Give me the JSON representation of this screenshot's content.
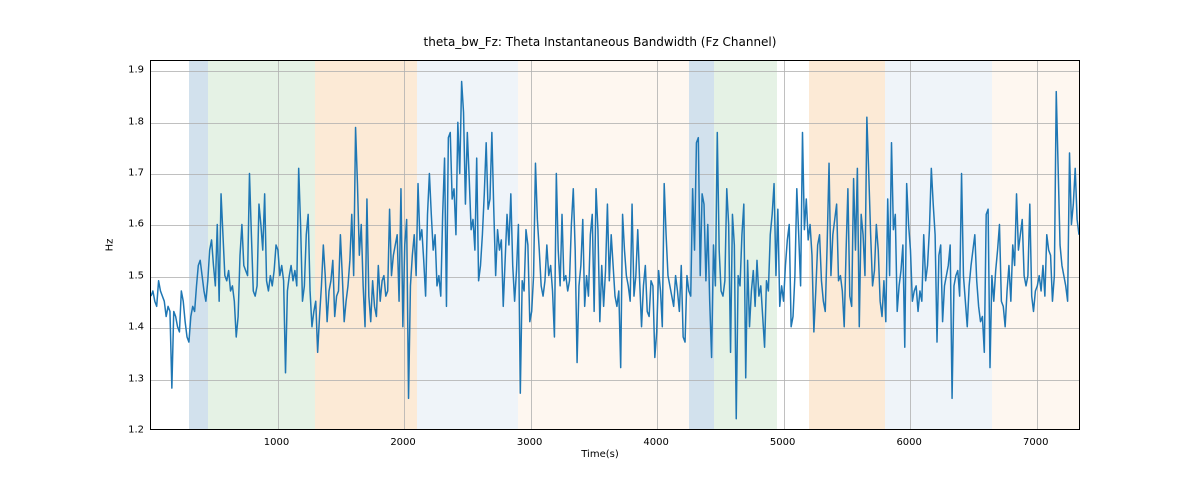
{
  "chart_data": {
    "type": "line",
    "title": "theta_bw_Fz: Theta Instantaneous Bandwidth (Fz Channel)",
    "xlabel": "Time(s)",
    "ylabel": "Hz",
    "xlim": [
      0,
      7350
    ],
    "ylim": [
      1.2,
      1.92
    ],
    "xticks": [
      1000,
      2000,
      3000,
      4000,
      5000,
      6000,
      7000
    ],
    "yticks": [
      1.2,
      1.3,
      1.4,
      1.5,
      1.6,
      1.7,
      1.8,
      1.9
    ],
    "bands": [
      {
        "x0": 300,
        "x1": 450,
        "color": "#6b9bc3"
      },
      {
        "x0": 450,
        "x1": 1300,
        "color": "#a8d5a8"
      },
      {
        "x0": 1300,
        "x1": 2100,
        "color": "#f5b878"
      },
      {
        "x0": 2100,
        "x1": 2900,
        "color": "#c9d9ec"
      },
      {
        "x0": 2900,
        "x1": 4250,
        "color": "#fde5cc"
      },
      {
        "x0": 4250,
        "x1": 4450,
        "color": "#6b9bc3"
      },
      {
        "x0": 4450,
        "x1": 4950,
        "color": "#a8d5a8"
      },
      {
        "x0": 5200,
        "x1": 5800,
        "color": "#f5b878"
      },
      {
        "x0": 5800,
        "x1": 6650,
        "color": "#c9d9ec"
      },
      {
        "x0": 6650,
        "x1": 7350,
        "color": "#fde5cc"
      }
    ],
    "series": [
      {
        "name": "theta_bw_Fz",
        "color": "#1f77b4",
        "x_start": 0,
        "x_step": 15,
        "values": [
          1.46,
          1.47,
          1.45,
          1.44,
          1.49,
          1.47,
          1.46,
          1.45,
          1.42,
          1.44,
          1.43,
          1.28,
          1.43,
          1.42,
          1.4,
          1.39,
          1.47,
          1.45,
          1.41,
          1.38,
          1.37,
          1.42,
          1.44,
          1.43,
          1.48,
          1.52,
          1.53,
          1.5,
          1.47,
          1.45,
          1.49,
          1.55,
          1.57,
          1.52,
          1.48,
          1.6,
          1.45,
          1.66,
          1.58,
          1.5,
          1.49,
          1.51,
          1.47,
          1.48,
          1.45,
          1.38,
          1.42,
          1.54,
          1.6,
          1.52,
          1.51,
          1.5,
          1.7,
          1.58,
          1.47,
          1.46,
          1.48,
          1.64,
          1.6,
          1.55,
          1.66,
          1.49,
          1.47,
          1.5,
          1.48,
          1.51,
          1.56,
          1.55,
          1.5,
          1.52,
          1.49,
          1.31,
          1.47,
          1.5,
          1.52,
          1.49,
          1.51,
          1.48,
          1.71,
          1.6,
          1.45,
          1.48,
          1.58,
          1.62,
          1.47,
          1.4,
          1.43,
          1.45,
          1.35,
          1.42,
          1.48,
          1.56,
          1.5,
          1.41,
          1.47,
          1.49,
          1.53,
          1.42,
          1.46,
          1.47,
          1.58,
          1.5,
          1.41,
          1.45,
          1.48,
          1.53,
          1.62,
          1.5,
          1.79,
          1.68,
          1.54,
          1.6,
          1.48,
          1.4,
          1.65,
          1.46,
          1.41,
          1.49,
          1.44,
          1.42,
          1.52,
          1.45,
          1.49,
          1.5,
          1.46,
          1.47,
          1.63,
          1.5,
          1.54,
          1.56,
          1.58,
          1.45,
          1.67,
          1.4,
          1.56,
          1.61,
          1.26,
          1.48,
          1.54,
          1.58,
          1.5,
          1.68,
          1.57,
          1.59,
          1.53,
          1.46,
          1.62,
          1.7,
          1.62,
          1.55,
          1.58,
          1.48,
          1.5,
          1.46,
          1.62,
          1.73,
          1.44,
          1.77,
          1.78,
          1.65,
          1.67,
          1.58,
          1.8,
          1.7,
          1.88,
          1.82,
          1.64,
          1.78,
          1.69,
          1.59,
          1.61,
          1.55,
          1.73,
          1.49,
          1.52,
          1.58,
          1.66,
          1.76,
          1.63,
          1.65,
          1.78,
          1.63,
          1.5,
          1.59,
          1.55,
          1.57,
          1.44,
          1.53,
          1.62,
          1.56,
          1.66,
          1.52,
          1.45,
          1.51,
          1.6,
          1.27,
          1.49,
          1.47,
          1.59,
          1.56,
          1.41,
          1.43,
          1.5,
          1.72,
          1.61,
          1.55,
          1.48,
          1.46,
          1.49,
          1.56,
          1.5,
          1.52,
          1.47,
          1.38,
          1.7,
          1.55,
          1.48,
          1.62,
          1.49,
          1.5,
          1.47,
          1.49,
          1.6,
          1.67,
          1.55,
          1.33,
          1.48,
          1.52,
          1.61,
          1.44,
          1.5,
          1.46,
          1.58,
          1.62,
          1.43,
          1.67,
          1.59,
          1.41,
          1.52,
          1.44,
          1.51,
          1.64,
          1.49,
          1.58,
          1.52,
          1.46,
          1.44,
          1.47,
          1.32,
          1.62,
          1.55,
          1.5,
          1.48,
          1.45,
          1.64,
          1.46,
          1.5,
          1.59,
          1.49,
          1.4,
          1.48,
          1.52,
          1.43,
          1.42,
          1.49,
          1.48,
          1.34,
          1.39,
          1.51,
          1.47,
          1.4,
          1.68,
          1.58,
          1.5,
          1.48,
          1.46,
          1.44,
          1.5,
          1.47,
          1.43,
          1.52,
          1.38,
          1.37,
          1.5,
          1.47,
          1.46,
          1.67,
          1.55,
          1.76,
          1.77,
          1.5,
          1.66,
          1.64,
          1.49,
          1.6,
          1.45,
          1.34,
          1.56,
          1.48,
          1.78,
          1.55,
          1.47,
          1.46,
          1.49,
          1.67,
          1.6,
          1.35,
          1.62,
          1.56,
          1.22,
          1.5,
          1.48,
          1.58,
          1.64,
          1.3,
          1.53,
          1.4,
          1.47,
          1.51,
          1.44,
          1.53,
          1.46,
          1.48,
          1.42,
          1.36,
          1.49,
          1.47,
          1.58,
          1.62,
          1.68,
          1.5,
          1.63,
          1.44,
          1.48,
          1.45,
          1.52,
          1.57,
          1.6,
          1.4,
          1.42,
          1.5,
          1.67,
          1.58,
          1.48,
          1.78,
          1.59,
          1.65,
          1.57,
          1.6,
          1.54,
          1.39,
          1.47,
          1.56,
          1.58,
          1.49,
          1.45,
          1.43,
          1.56,
          1.72,
          1.5,
          1.58,
          1.61,
          1.64,
          1.49,
          1.5,
          1.47,
          1.4,
          1.55,
          1.67,
          1.46,
          1.44,
          1.69,
          1.55,
          1.71,
          1.4,
          1.62,
          1.58,
          1.5,
          1.81,
          1.7,
          1.58,
          1.48,
          1.51,
          1.6,
          1.55,
          1.45,
          1.42,
          1.49,
          1.41,
          1.65,
          1.5,
          1.76,
          1.59,
          1.62,
          1.43,
          1.48,
          1.51,
          1.56,
          1.36,
          1.68,
          1.6,
          1.55,
          1.45,
          1.47,
          1.48,
          1.43,
          1.47,
          1.45,
          1.58,
          1.49,
          1.52,
          1.59,
          1.71,
          1.64,
          1.58,
          1.37,
          1.54,
          1.56,
          1.41,
          1.48,
          1.5,
          1.52,
          1.56,
          1.26,
          1.48,
          1.5,
          1.51,
          1.46,
          1.7,
          1.5,
          1.45,
          1.4,
          1.48,
          1.52,
          1.55,
          1.58,
          1.49,
          1.44,
          1.41,
          1.42,
          1.35,
          1.62,
          1.63,
          1.32,
          1.5,
          1.45,
          1.51,
          1.55,
          1.6,
          1.45,
          1.44,
          1.4,
          1.47,
          1.52,
          1.45,
          1.56,
          1.52,
          1.66,
          1.55,
          1.58,
          1.61,
          1.5,
          1.48,
          1.5,
          1.64,
          1.46,
          1.43,
          1.47,
          1.48,
          1.5,
          1.47,
          1.52,
          1.46,
          1.58,
          1.55,
          1.54,
          1.45,
          1.5,
          1.86,
          1.71,
          1.56,
          1.52,
          1.5,
          1.48,
          1.45,
          1.74,
          1.6,
          1.64,
          1.71,
          1.61,
          1.58
        ]
      }
    ]
  }
}
